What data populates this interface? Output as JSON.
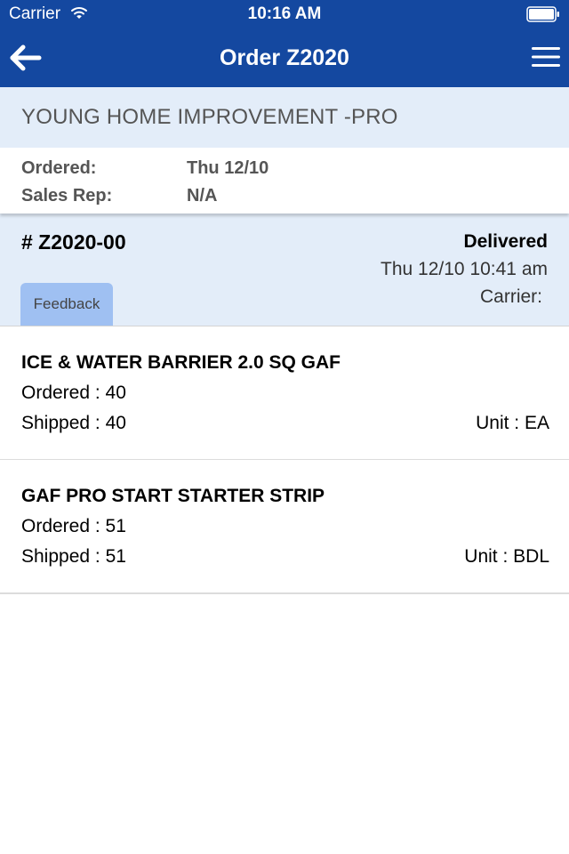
{
  "status_bar": {
    "carrier": "Carrier",
    "time": "10:16 AM",
    "icons": [
      "wifi-icon",
      "battery-icon"
    ]
  },
  "nav": {
    "title": "Order Z2020",
    "back_icon": "back-arrow-icon",
    "menu_icon": "hamburger-menu-icon"
  },
  "customer": {
    "name": "YOUNG HOME IMPROVEMENT -PRO"
  },
  "order": {
    "ordered_label": "Ordered:",
    "ordered_value": "Thu 12/10",
    "sales_rep_label": "Sales Rep:",
    "sales_rep_value": "N/A"
  },
  "shipment": {
    "id": "# Z2020-00",
    "status": "Delivered",
    "datetime": "Thu 12/10 10:41 am",
    "carrier": "Carrier:",
    "feedback_label": "Feedback"
  },
  "items": [
    {
      "name": "ICE & WATER BARRIER 2.0 SQ GAF",
      "ordered": "Ordered : 40",
      "shipped": "Shipped : 40",
      "unit": "Unit : EA"
    },
    {
      "name": "GAF PRO START STARTER STRIP",
      "ordered": "Ordered : 51",
      "shipped": "Shipped : 51",
      "unit": "Unit : BDL"
    }
  ],
  "colors": {
    "nav_background": "#1448a0",
    "light_band": "#e3edf9",
    "feedback_button": "#9fc0f2"
  }
}
